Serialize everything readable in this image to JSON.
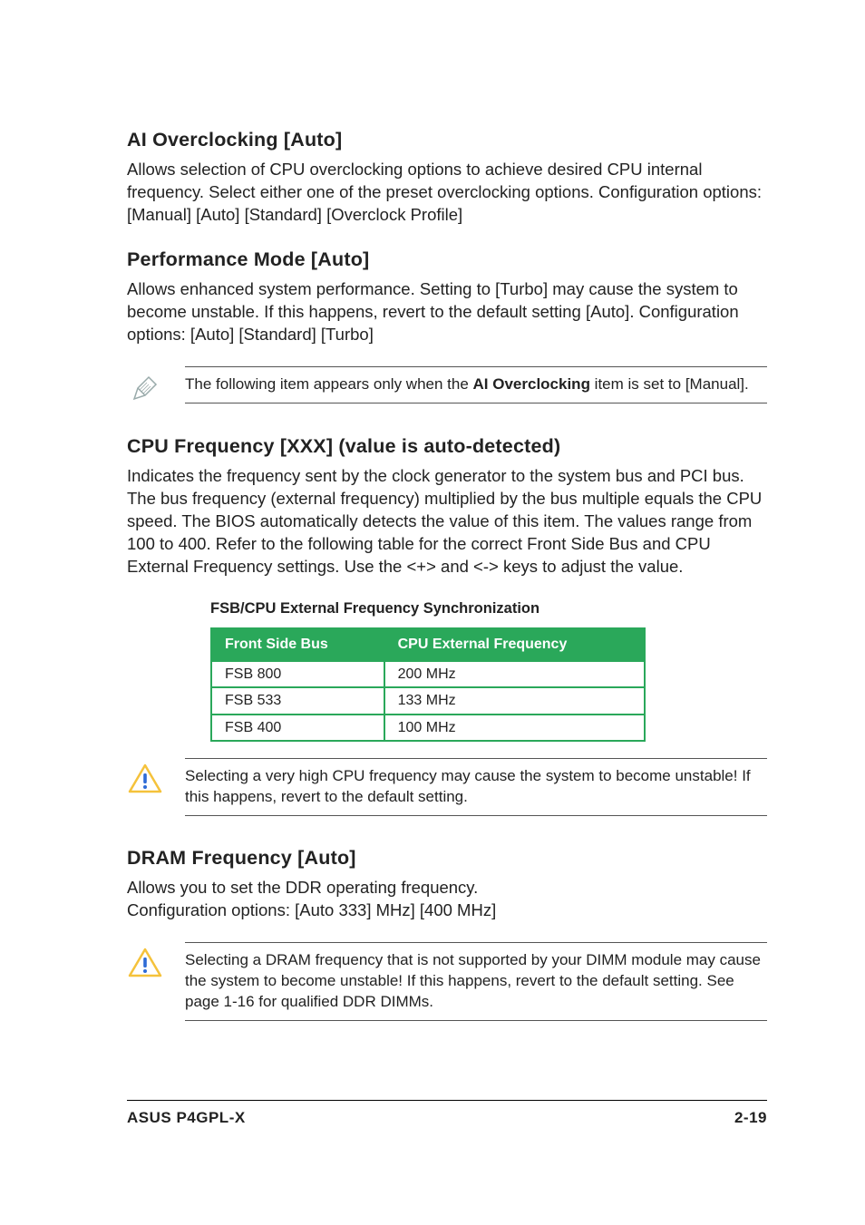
{
  "sections": {
    "ai_overclocking": {
      "heading": "AI Overclocking [Auto]",
      "body": "Allows selection of CPU overclocking options to achieve desired CPU internal frequency. Select either one of the preset overclocking options. Configuration options: [Manual] [Auto] [Standard] [Overclock Profile]"
    },
    "performance_mode": {
      "heading": "Performance Mode [Auto]",
      "body": "Allows enhanced system performance. Setting to [Turbo] may cause the system to become unstable. If this happens, revert to the default setting [Auto]. Configuration options: [Auto] [Standard] [Turbo]"
    },
    "note1": {
      "pre": "The following item appears only when the ",
      "keyword": "AI Overclocking",
      "post": " item is set to [Manual]."
    },
    "cpu_freq": {
      "heading": "CPU Frequency [XXX] (value is auto-detected)",
      "body": "Indicates the frequency sent by the clock generator to the system bus and PCI bus. The bus frequency (external frequency) multiplied by the bus multiple equals the CPU speed. The BIOS automatically detects the value of this item. The values range from 100 to 400. Refer to the following table for the correct Front Side Bus and CPU External Frequency settings. Use the <+> and <-> keys to adjust the value."
    },
    "table": {
      "caption": "FSB/CPU External Frequency Synchronization",
      "head": {
        "c1": "Front Side Bus",
        "c2": "CPU External Frequency"
      },
      "rows": [
        {
          "c1": "FSB 800",
          "c2": "200 MHz"
        },
        {
          "c1": "FSB 533",
          "c2": "133 MHz"
        },
        {
          "c1": "FSB 400",
          "c2": "100 MHz"
        }
      ]
    },
    "note2": {
      "text": "Selecting a very high CPU frequency may cause the system to become unstable! If this happens, revert to the default setting."
    },
    "dram": {
      "heading": "DRAM Frequency [Auto]",
      "body": "Allows you to set the DDR operating frequency.\nConfiguration options: [Auto 333] MHz] [400 MHz]"
    },
    "note3": {
      "text": "Selecting a DRAM frequency that is not supported by your DIMM module may cause the system to become unstable! If this happens, revert to the default setting. See page 1-16 for qualified DDR DIMMs."
    }
  },
  "footer": {
    "left": "ASUS P4GPL-X",
    "right": "2-19"
  }
}
